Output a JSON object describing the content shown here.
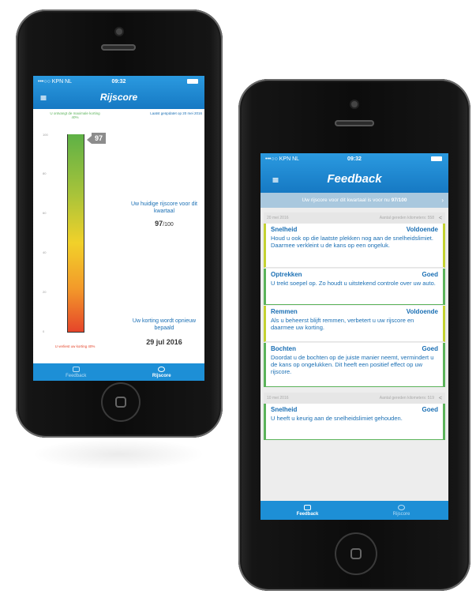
{
  "status_bar": {
    "carrier": "•••○○ KPN NL",
    "time": "09:32"
  },
  "left_screen": {
    "title": "Rijscore",
    "legend_top_left": "U ontvangt de maximale korting\n40%",
    "legend_top_right": "Laatst geüpdatet op 20 mei 2016",
    "legend_bottom_left": "U verliest uw korting 40%",
    "y_ticks": [
      "100",
      "80",
      "60",
      "40",
      "20",
      "0"
    ],
    "score_badge": "97",
    "current_score_label": "Uw huidige rijscore voor dit kwartaal",
    "current_score_value": "97",
    "current_score_max": "/100",
    "reset_label": "Uw korting wordt opnieuw bepaald",
    "reset_date": "29 jul 2016",
    "tabs": [
      {
        "label": "Feedback",
        "icon": "chat-icon"
      },
      {
        "label": "Rijscore",
        "icon": "gauge-icon"
      }
    ]
  },
  "right_screen": {
    "title": "Feedback",
    "banner_text": "Uw rijscore voor dit kwartaal is voor nu",
    "banner_score": "97/100",
    "days": [
      {
        "date": "20 mei 2016",
        "km": "Aantal gereden kilometers: 558",
        "items": [
          {
            "title": "Snelheid",
            "rating": "Voldoende",
            "text": "Houd u ook op die laatste plekken nog aan de snelheidslimiet. Daarmee verkleint u de kans op een ongeluk."
          },
          {
            "title": "Optrekken",
            "rating": "Goed",
            "text": "U trekt soepel op. Zo houdt u uitstekend controle over uw auto."
          },
          {
            "title": "Remmen",
            "rating": "Voldoende",
            "text": "Als u beheerst blijft remmen, verbetert u uw rijscore en daarmee uw korting."
          },
          {
            "title": "Bochten",
            "rating": "Goed",
            "text": "Doordat u de bochten op de juiste manier neemt, vermindert u de kans op ongelukken. Dit heeft een positief effect op uw rijscore."
          }
        ]
      },
      {
        "date": "10 mei 2016",
        "km": "Aantal gereden kilometers: 519",
        "items": [
          {
            "title": "Snelheid",
            "rating": "Goed",
            "text": "U heeft u keurig aan de snelheidslimiet gehouden."
          }
        ]
      }
    ],
    "tabs": [
      {
        "label": "Feedback",
        "icon": "chat-icon"
      },
      {
        "label": "Rijscore",
        "icon": "gauge-icon"
      }
    ]
  },
  "colors": {
    "primary": "#1d8fd6",
    "good": "#5bb35a",
    "sufficient": "#c4d232"
  }
}
